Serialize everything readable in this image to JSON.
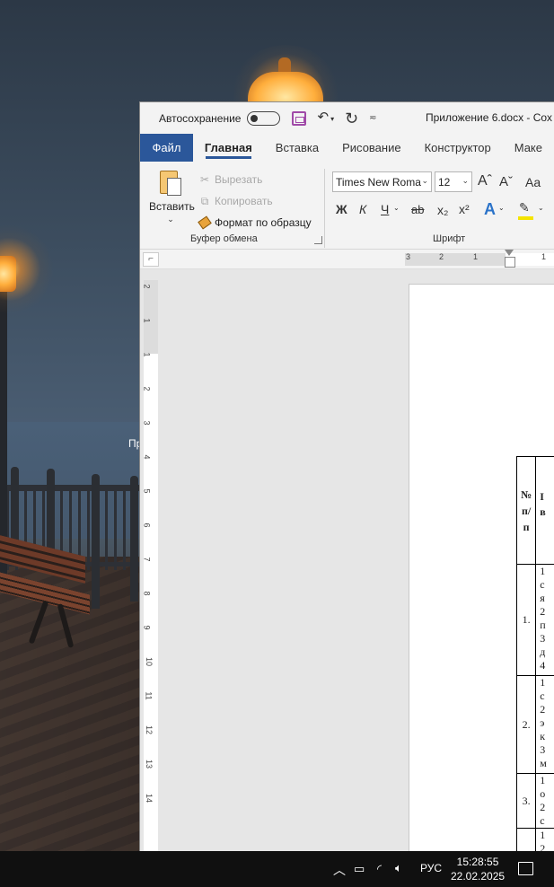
{
  "window": {
    "autosave_label": "Автосохранение",
    "doc_title": "Приложение 6.docx  -  Сох"
  },
  "tabs": [
    "Файл",
    "Главная",
    "Вставка",
    "Рисование",
    "Конструктор",
    "Маке"
  ],
  "ribbon": {
    "clipboard": {
      "paste_label": "Вставить",
      "cut_label": "Вырезать",
      "copy_label": "Копировать",
      "format_painter_label": "Формат по образцу",
      "group_label": "Буфер обмена"
    },
    "font": {
      "font_name": "Times New Roma",
      "font_size": "12",
      "grow_font": "Aˆ",
      "shrink_font": "Aˇ",
      "change_case": "Aa",
      "bold": "Ж",
      "italic": "К",
      "underline": "Ч",
      "strikethrough": "ab",
      "subscript": "x₂",
      "superscript": "x²",
      "text_effects": "A",
      "group_label": "Шрифт"
    }
  },
  "ruler": {
    "horizontal_numbers": [
      "3",
      "2",
      "1",
      "1"
    ],
    "vertical_numbers": [
      "2",
      "1",
      "1",
      "2",
      "3",
      "4",
      "5",
      "6",
      "7",
      "8",
      "9",
      "10",
      "11",
      "12",
      "13",
      "14"
    ]
  },
  "document": {
    "header_cell": "№\nп/\nп",
    "header_col2": "І\nв",
    "rows": [
      {
        "num": "1.",
        "text": "1\nс\nя\n2\nп\n3\nд\n4"
      },
      {
        "num": "2.",
        "text": "1\nс\n2\nэ\nк\n3\nм"
      },
      {
        "num": "3.",
        "text": "1\nо\n2\nс"
      },
      {
        "num": "",
        "text": "1\n2"
      }
    ]
  },
  "desktop": {
    "stray_text": "Пр"
  },
  "taskbar": {
    "language": "РУС",
    "time": "15:28:55",
    "date": "22.02.2025"
  }
}
